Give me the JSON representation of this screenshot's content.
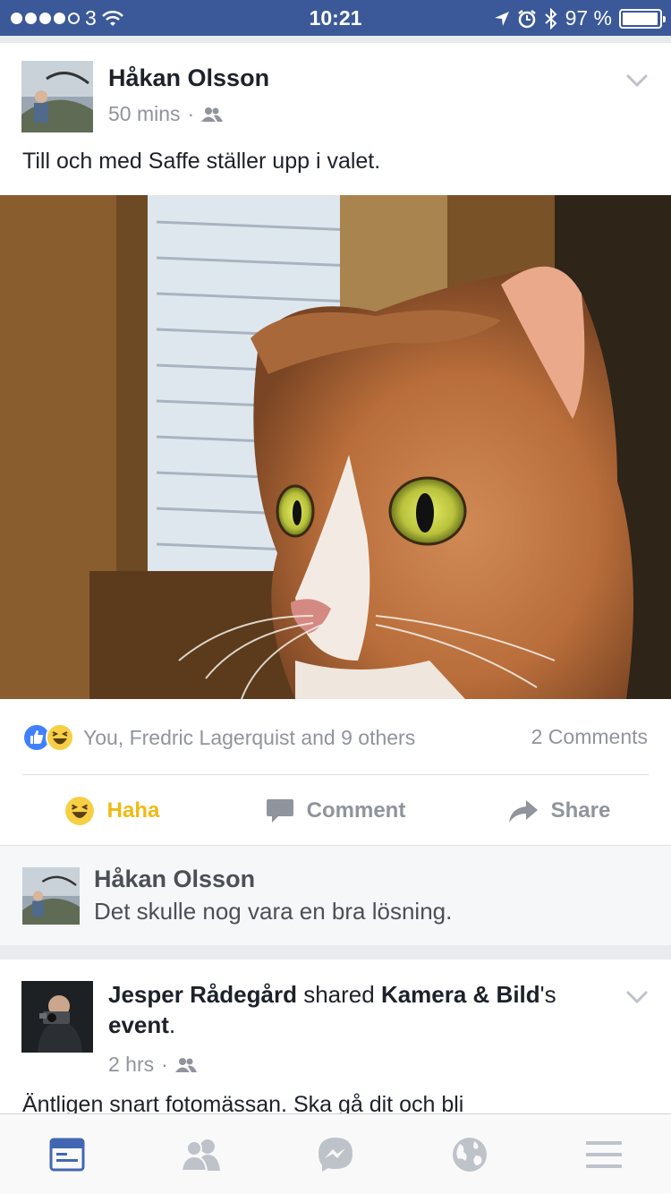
{
  "status_bar": {
    "carrier": "3",
    "time": "10:21",
    "battery": "97 %",
    "battery_level": 0.97
  },
  "post1": {
    "author": "Håkan Olsson",
    "time": "50 mins",
    "dot": "·",
    "audience_icon": "friends-icon",
    "text": "Till och med Saffe ställer upp i valet.",
    "reactions_summary": "You, Fredric Lagerquist and 9 others",
    "comments_count": "2 Comments",
    "actions": {
      "haha": "Haha",
      "comment": "Comment",
      "share": "Share"
    },
    "comment": {
      "author": "Håkan Olsson",
      "text": "Det skulle nog vara en bra lösning."
    }
  },
  "post2": {
    "author": "Jesper Rådegård",
    "verb": " shared ",
    "page": "Kamera & Bild",
    "suffix": "'s",
    "object": "event",
    "period": ".",
    "time": "2 hrs",
    "dot": "·",
    "text": "Äntligen snart fotomässan. Ska gå dit och bli"
  },
  "tabs": [
    "news-feed-icon",
    "friends-icon",
    "messenger-icon",
    "notifications-globe-icon",
    "menu-icon"
  ],
  "colors": {
    "brand": "#3b5998",
    "haha": "#f0ba15",
    "like": "#4080ff",
    "active_tab": "#4267b2",
    "inactive_tab": "#bec2c9"
  }
}
